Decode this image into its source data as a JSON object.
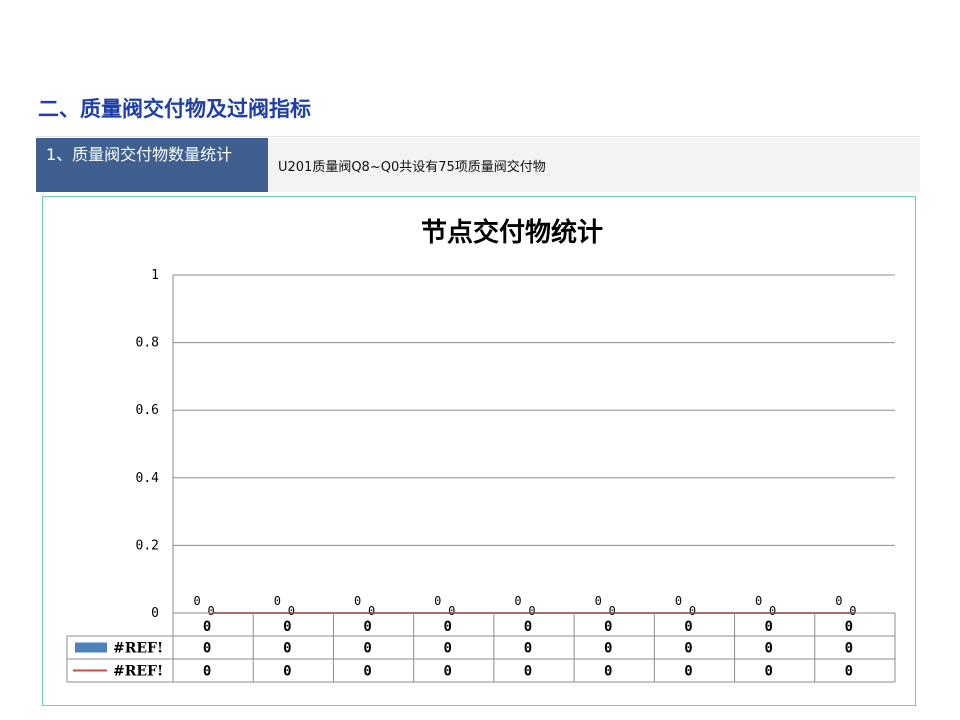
{
  "section": {
    "title": "二、质量阀交付物及过阀指标"
  },
  "label": {
    "name": "1、质量阀交付物数量统计",
    "description": "U201质量阀Q8~Q0共设有75项质量阀交付物"
  },
  "colors": {
    "label_bg": "#3e5f8f",
    "series_bar": "#4f81bd",
    "series_line": "#c0504d",
    "frame": "#6fd3a8"
  },
  "chart_data": {
    "type": "bar",
    "title": "节点交付物统计",
    "xlabel": "",
    "ylabel": "",
    "ylim": [
      0,
      1
    ],
    "yticks": [
      "0",
      "0.2",
      "0.4",
      "0.6",
      "0.8",
      "1"
    ],
    "grid": true,
    "categories": [
      "0",
      "0",
      "0",
      "0",
      "0",
      "0",
      "0",
      "0",
      "0"
    ],
    "series": [
      {
        "name": "#REF!",
        "kind": "bar",
        "values": [
          0,
          0,
          0,
          0,
          0,
          0,
          0,
          0,
          0
        ]
      },
      {
        "name": "#REF!",
        "kind": "line",
        "values": [
          0,
          0,
          0,
          0,
          0,
          0,
          0,
          0,
          0
        ]
      }
    ],
    "data_table": true
  }
}
